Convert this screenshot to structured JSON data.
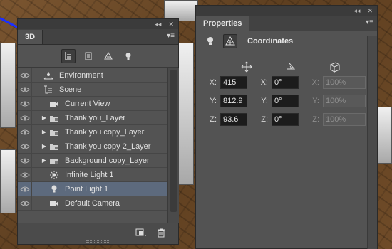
{
  "panel3d": {
    "window_controls": [
      "◂◂",
      "✕"
    ],
    "tab": "3D",
    "menu_icon": "panel-menu-icon",
    "filter_tools": [
      {
        "name": "scene-filter-icon",
        "active": true
      },
      {
        "name": "meshes-filter-icon",
        "active": false
      },
      {
        "name": "materials-filter-icon",
        "active": false
      },
      {
        "name": "lights-filter-icon",
        "active": false
      }
    ],
    "layers": [
      {
        "label": "Environment",
        "icon": "environment-icon",
        "expand": false,
        "indent": 0,
        "selected": false
      },
      {
        "label": "Scene",
        "icon": "scene-icon",
        "expand": false,
        "indent": 0,
        "selected": false
      },
      {
        "label": "Current View",
        "icon": "camera-icon",
        "expand": false,
        "indent": 1,
        "selected": false
      },
      {
        "label": "Thank you_Layer",
        "icon": "mesh-icon",
        "expand": true,
        "indent": 1,
        "selected": false
      },
      {
        "label": "Thank you copy_Layer",
        "icon": "mesh-icon",
        "expand": true,
        "indent": 1,
        "selected": false
      },
      {
        "label": "Thank you copy 2_Layer",
        "icon": "mesh-icon",
        "expand": true,
        "indent": 1,
        "selected": false
      },
      {
        "label": "Background copy_Layer",
        "icon": "mesh-icon",
        "expand": true,
        "indent": 1,
        "selected": false
      },
      {
        "label": "Infinite Light 1",
        "icon": "infinite-light-icon",
        "expand": false,
        "indent": 1,
        "selected": false
      },
      {
        "label": "Point Light 1",
        "icon": "point-light-icon",
        "expand": false,
        "indent": 1,
        "selected": true
      },
      {
        "label": "Default Camera",
        "icon": "camera-icon",
        "expand": false,
        "indent": 1,
        "selected": false
      }
    ]
  },
  "properties": {
    "window_controls": [
      "◂◂",
      "✕"
    ],
    "tab": "Properties",
    "section_title": "Coordinates",
    "column_icons": [
      "move-icon",
      "rotate-icon",
      "scale-icon"
    ],
    "rows": [
      {
        "label": "X:",
        "position": "415",
        "rot_label": "X:",
        "rotation": "0°",
        "scale_label": "X:",
        "scale": "100%"
      },
      {
        "label": "Y:",
        "position": "812.9",
        "rot_label": "Y:",
        "rotation": "0°",
        "scale_label": "Y:",
        "scale": "100%"
      },
      {
        "label": "Z:",
        "position": "93.6",
        "rot_label": "Z:",
        "rotation": "0°",
        "scale_label": "Z:",
        "scale": "100%"
      }
    ]
  },
  "colors": {
    "panel_bg": "#535353",
    "selected_row": "#5d6a7d",
    "input_bg": "#1c1c1c"
  }
}
